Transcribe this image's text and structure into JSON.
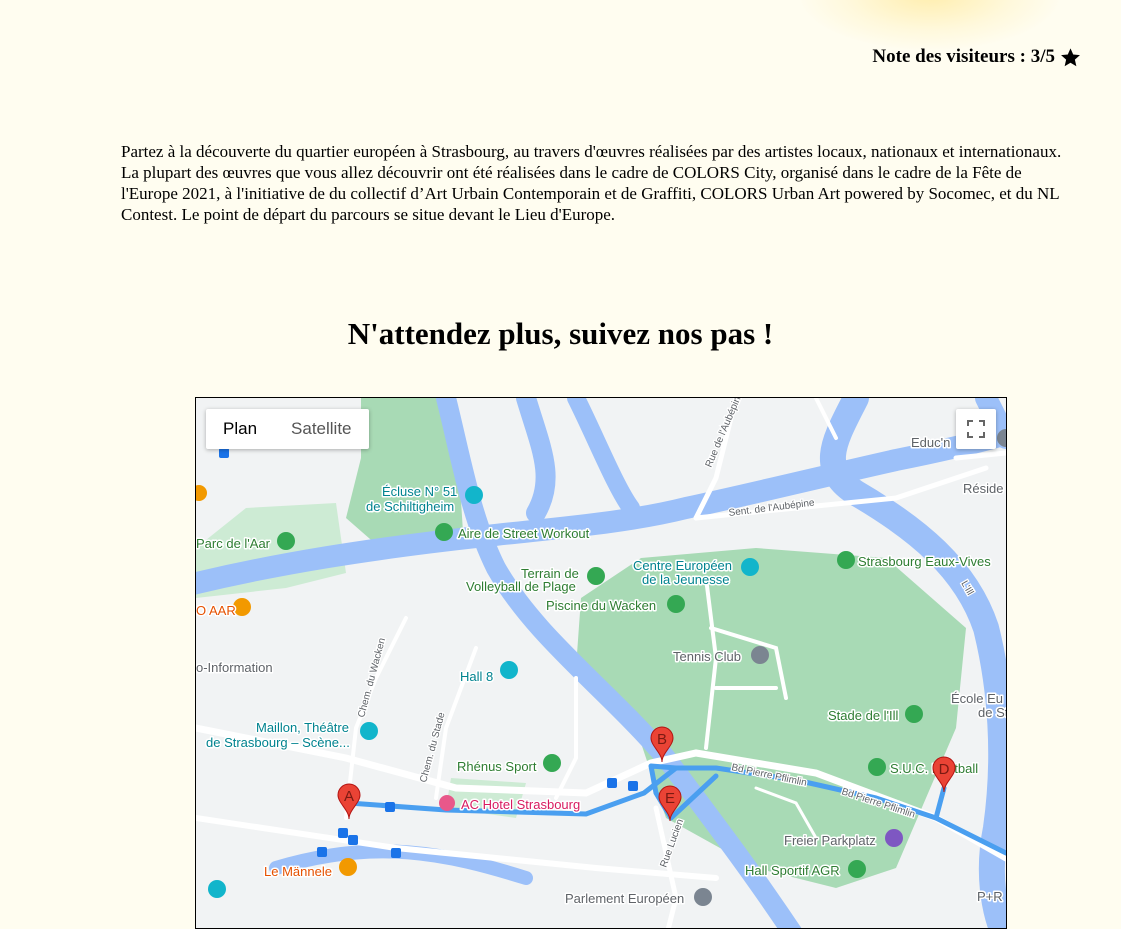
{
  "rating": {
    "label": "Note des visiteurs : 3/5",
    "value": 3,
    "max": 5
  },
  "intro": "Partez à la découverte du quartier européen à Strasbourg, au travers d'œuvres réalisées par des artistes locaux, nationaux et internationaux. La plupart des œuvres que vous allez découvrir ont été réalisées dans le cadre de COLORS City, organisé dans le cadre de la Fête de l'Europe 2021, à l'initiative de du collectif d’Art Urbain Contemporain et de Graffiti, COLORS Urban Art powered by Socomec, et du NL Contest. Le point de départ du parcours se situe devant le Lieu d'Europe.",
  "heading": "N'attendez plus, suivez nos pas !",
  "map": {
    "type_controls": {
      "plan": "Plan",
      "satellite": "Satellite",
      "active": "plan"
    },
    "colors": {
      "water": "#9cc0f9",
      "park": "#a8dab5",
      "route": "#4a9ff0",
      "marker": "#ea4335",
      "land": "#f1f3f4"
    },
    "markers": [
      "A",
      "B",
      "D",
      "E"
    ],
    "places": {
      "ecluse_1": "Écluse N° 51",
      "ecluse_2": "de Schiltigheim",
      "aire": "Aire de Street Workout",
      "parc_aar": "Parc de l'Aar",
      "terrain_1": "Terrain de",
      "terrain_2": "Volleyball de Plage",
      "centre_1": "Centre Européen",
      "centre_2": "de la Jeunesse",
      "eaux_vives": "Strasbourg Eaux-Vives",
      "piscine": "Piscine du Wacken",
      "aar": "O AAR",
      "info": "o-Information",
      "tennis": "Tennis Club",
      "hall8": "Hall 8",
      "maillon_1": "Maillon, Théâtre",
      "maillon_2": "de Strasbourg – Scène...",
      "stade_ill": "Stade de l'Ill",
      "ecole_1": "École Eu",
      "ecole_2": "de St",
      "rhenus": "Rhénus Sport",
      "suc": "S.U.C. Football",
      "ac_hotel": "AC Hotel Strasbourg",
      "freier": "Freier Parkplatz",
      "mannele": "Le Männele",
      "hall_agr": "Hall Sportif AGR",
      "parlement": "Parlement Européen",
      "educn": "Educ'n",
      "reside": "Réside",
      "pr": "P+R"
    },
    "roads": {
      "aubepine": "Rue de l'Aubépine",
      "sent_aubepine": "Sent. de l'Aubépine",
      "wacken": "Chem. du Wacken",
      "stade": "Chem. du Stade",
      "pflimlin_1": "Bd Pierre Pflimlin",
      "pflimlin_2": "Bd Pierre Pflimlin",
      "lucien": "Rue Lucien",
      "ill": "L'Ill"
    }
  }
}
